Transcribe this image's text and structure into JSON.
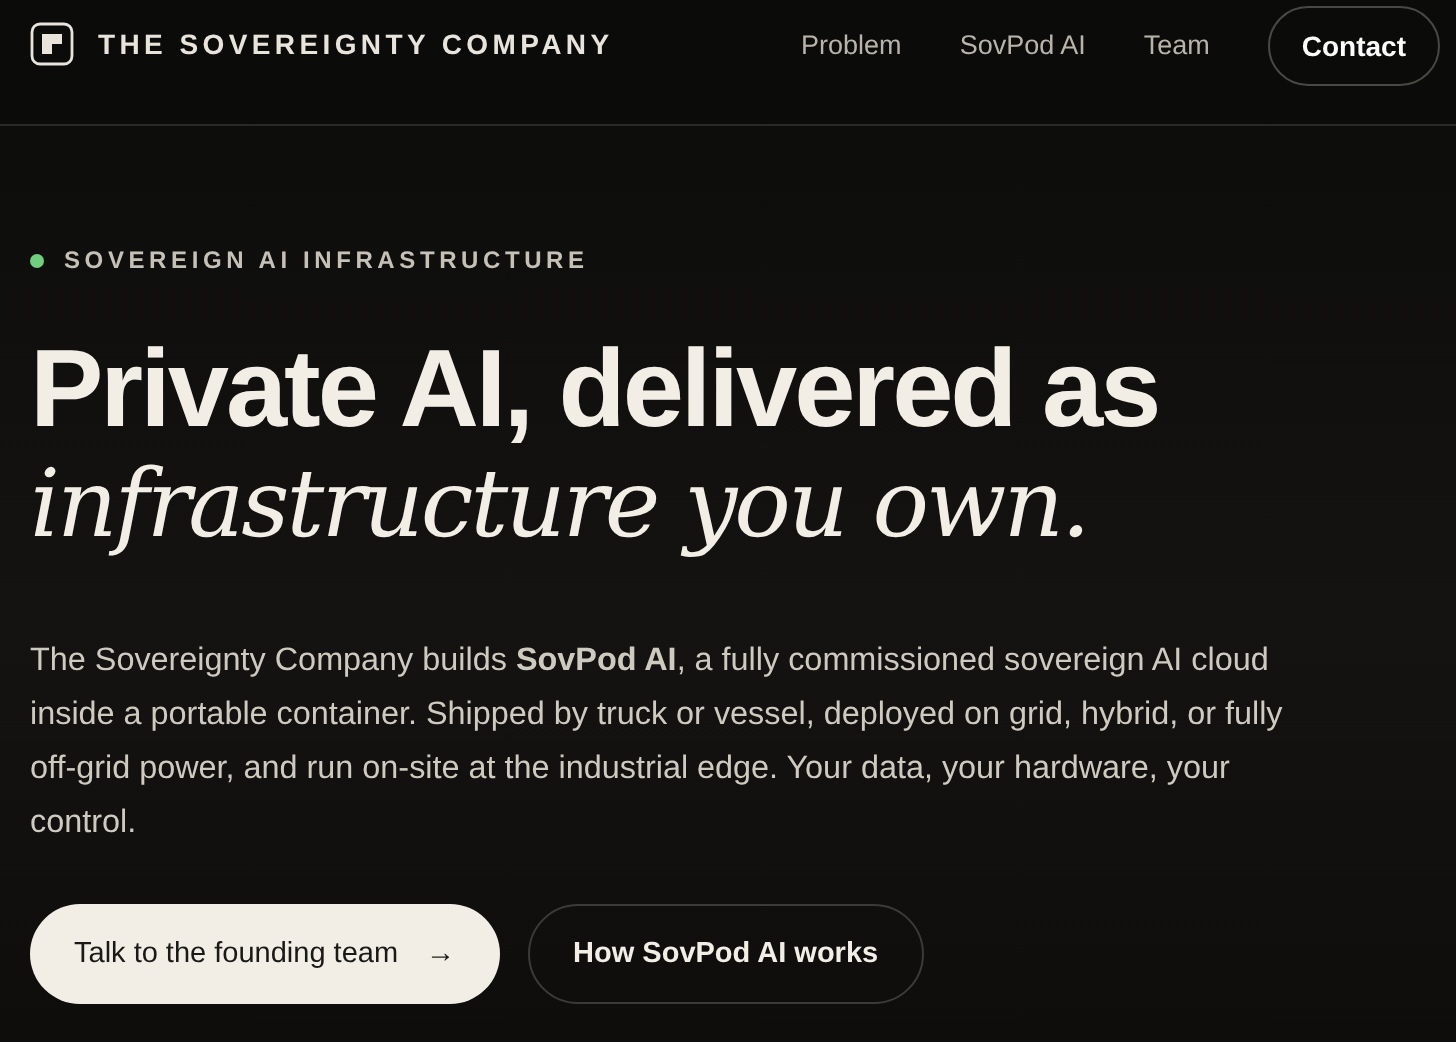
{
  "brand": {
    "name": "THE SOVEREIGNTY COMPANY"
  },
  "nav": [
    {
      "label": "Problem",
      "kind": "link"
    },
    {
      "label": "SovPod AI",
      "kind": "link"
    },
    {
      "label": "Team",
      "kind": "link"
    },
    {
      "label": "Contact",
      "kind": "button"
    }
  ],
  "hero": {
    "eyebrow": "SOVEREIGN AI INFRASTRUCTURE",
    "headline": "Private AI, delivered as",
    "headline_italic": "infrastructure you own.",
    "body": "The Sovereignty Company builds **SovPod AI**, a fully commissioned sovereign AI cloud inside a portable container. Shipped by truck or vessel, deployed on grid, hybrid, or fully off-grid power, and run on-site at the industrial edge. Your data, your hardware, your control.",
    "buttons": [
      {
        "label": "Talk to the founding team",
        "icon": "→",
        "kind": "primary"
      },
      {
        "label": "How SovPod AI works",
        "kind": "secondary"
      }
    ]
  }
}
